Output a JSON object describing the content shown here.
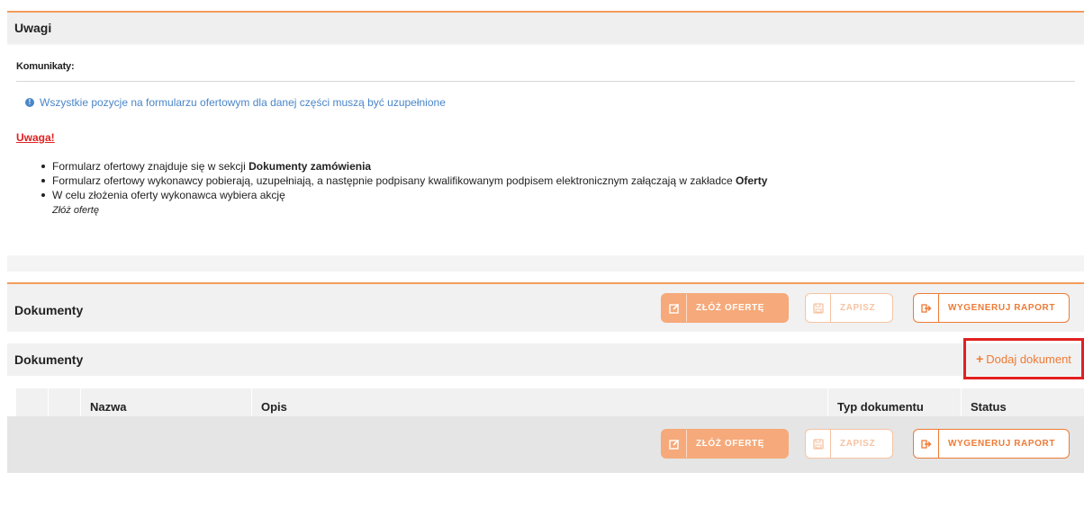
{
  "uwagi": {
    "title": "Uwagi",
    "komunikaty_label": "Komunikaty:",
    "info_message": "Wszystkie pozycje na formularzu ofertowym dla danej części muszą być uzupełnione",
    "uwaga_label": "Uwaga!",
    "items": [
      {
        "pre": "Formularz ofertowy znajduje się w sekcji ",
        "bold": "Dokumenty zamówienia",
        "post": ""
      },
      {
        "pre": "Formularz ofertowy wykonawcy pobierają, uzupełniają, a następnie podpisany kwalifikowanym podpisem elektronicznym załączają w zakładce ",
        "bold": "Oferty",
        "post": ""
      },
      {
        "pre": "W celu złożenia oferty wykonawca wybiera akcję",
        "bold": "",
        "post": ""
      }
    ],
    "sub_item": "Złóż ofertę"
  },
  "dokumenty": {
    "title": "Dokumenty",
    "sub_title": "Dokumenty",
    "add_document_label": "Dodaj dokument",
    "buttons": {
      "zloz_oferte": "ZŁÓŻ OFERTĘ",
      "zapisz": "ZAPISZ",
      "wygeneruj_raport": "WYGENERUJ RAPORT"
    },
    "table_columns": [
      "",
      "",
      "Nazwa",
      "Opis",
      "Typ dokumentu",
      "Status"
    ]
  },
  "colors": {
    "accent": "#ef7a35",
    "accent_light": "#f6a97a",
    "info": "#4a86c8",
    "warning": "#e02020",
    "highlight_border": "#e0201f"
  }
}
